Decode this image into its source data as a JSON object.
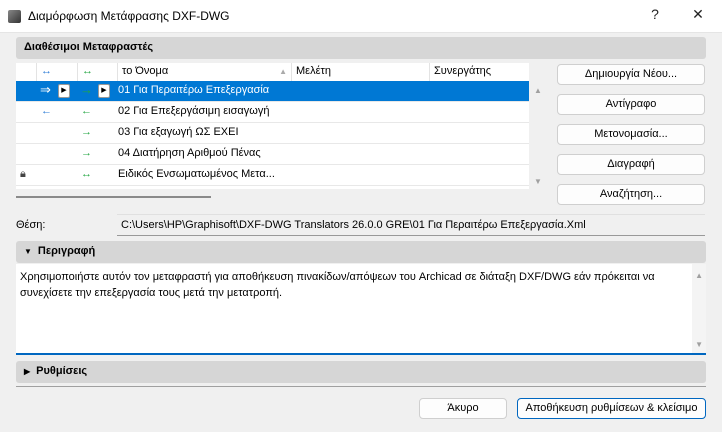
{
  "window": {
    "title": "Διαμόρφωση Μετάφρασης DXF-DWG",
    "help": "?",
    "close": "✕"
  },
  "translators": {
    "section_title": "Διαθέσιμοι Μεταφραστές",
    "columns": {
      "col1": "↔",
      "col2": "↔",
      "name": "το Όνομα",
      "project": "Μελέτη",
      "partner": "Συνεργάτης"
    },
    "rows": [
      {
        "c1": "⇒",
        "c2": "→",
        "name": "01 Για Περαιτέρω Επεξεργασία",
        "selected": true
      },
      {
        "c1": "←",
        "c2": "←",
        "name": "02 Για Επεξεργάσιμη εισαγωγή"
      },
      {
        "c1": "",
        "c2": "→",
        "name": "03 Για εξαγωγή ΩΣ ΕΧΕΙ"
      },
      {
        "c1": "",
        "c2": "→",
        "name": "04 Διατήρηση Αριθμού Πένας"
      },
      {
        "c1": "",
        "c2": "↔",
        "name": "Ειδικός Ενσωματωμένος Μετα...",
        "locked": true
      }
    ],
    "buttons": {
      "new": "Δημιουργία Νέου...",
      "copy": "Αντίγραφο",
      "rename": "Μετονομασία...",
      "delete": "Διαγραφή",
      "search": "Αναζήτηση..."
    }
  },
  "location": {
    "label": "Θέση:",
    "value": "C:\\Users\\HP\\Graphisoft\\DXF-DWG Translators 26.0.0 GRE\\01 Για Περαιτέρω Επεξεργασία.Xml"
  },
  "description": {
    "section_title": "Περιγραφή",
    "text": "Χρησιμοποιήστε αυτόν τον μεταφραστή για αποθήκευση πινακίδων/απόψεων του Archicad σε διάταξη DXF/DWG εάν πρόκειται να συνεχίσετε την επεξεργασία τους μετά την μετατροπή."
  },
  "settings": {
    "section_title": "Ρυθμίσεις"
  },
  "footer": {
    "cancel": "Άκυρο",
    "save": "Αποθήκευση ρυθμίσεων & κλείσιμο"
  }
}
